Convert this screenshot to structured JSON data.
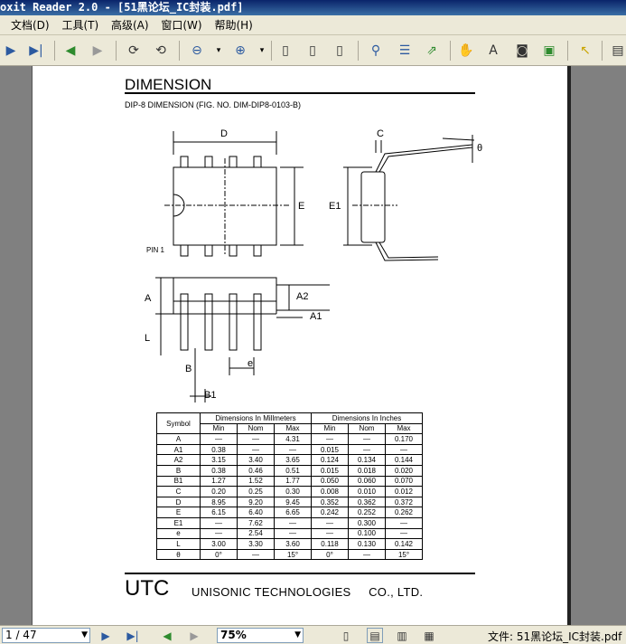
{
  "window": {
    "title": "oxit Reader 2.0 - [51黑论坛_IC封装.pdf]"
  },
  "menu": [
    "文档(D)",
    "工具(T)",
    "高级(A)",
    "窗口(W)",
    "帮助(H)"
  ],
  "document": {
    "heading": "DIMENSION",
    "subheading": "DIP-8 DIMENSION (FIG. NO. DIM-DIP8-0103-B)",
    "diagram_labels": {
      "D": "D",
      "C": "C",
      "theta": "θ",
      "E": "E",
      "E1": "E1",
      "pin1": "PIN 1",
      "A": "A",
      "A2": "A2",
      "A1": "A1",
      "L": "L",
      "B": "B",
      "e": "e",
      "B1": "B1"
    },
    "table": {
      "symbol_header": "Symbol",
      "mm_header": "Dimensions In Millmeters",
      "inch_header": "Dimensions In Inches",
      "sub_headers": [
        "Min",
        "Nom",
        "Max",
        "Min",
        "Nom",
        "Max"
      ],
      "rows": [
        [
          "A",
          "—",
          "—",
          "4.31",
          "—",
          "—",
          "0.170"
        ],
        [
          "A1",
          "0.38",
          "—",
          "—",
          "0.015",
          "—",
          "—"
        ],
        [
          "A2",
          "3.15",
          "3.40",
          "3.65",
          "0.124",
          "0.134",
          "0.144"
        ],
        [
          "B",
          "0.38",
          "0.46",
          "0.51",
          "0.015",
          "0.018",
          "0.020"
        ],
        [
          "B1",
          "1.27",
          "1.52",
          "1.77",
          "0.050",
          "0.060",
          "0.070"
        ],
        [
          "C",
          "0.20",
          "0.25",
          "0.30",
          "0.008",
          "0.010",
          "0.012"
        ],
        [
          "D",
          "8.95",
          "9.20",
          "9.45",
          "0.352",
          "0.362",
          "0.372"
        ],
        [
          "E",
          "6.15",
          "6.40",
          "6.65",
          "0.242",
          "0.252",
          "0.262"
        ],
        [
          "E1",
          "—",
          "7.62",
          "—",
          "—",
          "0.300",
          "—"
        ],
        [
          "e",
          "—",
          "2.54",
          "—",
          "—",
          "0.100",
          "—"
        ],
        [
          "L",
          "3.00",
          "3.30",
          "3.60",
          "0.118",
          "0.130",
          "0.142"
        ],
        [
          "θ",
          "0°",
          "—",
          "15°",
          "0°",
          "—",
          "15°"
        ]
      ]
    },
    "footer_logo": "UTC",
    "footer_company": "UNISONIC TECHNOLOGIES     CO., LTD."
  },
  "status": {
    "page": "1 / 47",
    "zoom": "75%",
    "file": "文件: 51黑论坛_IC封装.pdf"
  }
}
